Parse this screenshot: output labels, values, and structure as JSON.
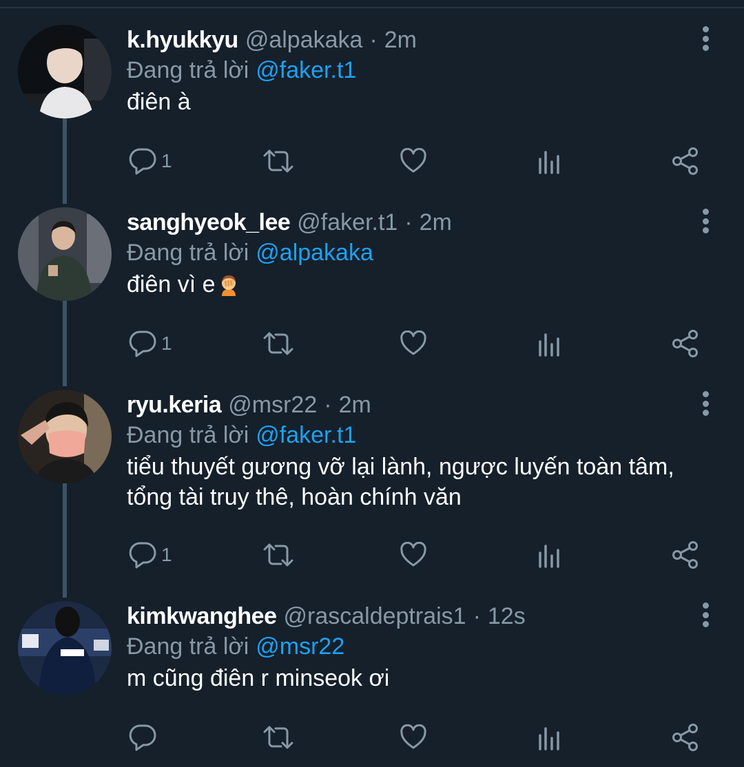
{
  "reply_prefix": "Đang trả lời",
  "colors": {
    "background": "#15202b",
    "text_primary": "#ffffff",
    "text_secondary": "#8899a6",
    "accent": "#1da1f2",
    "thread_line": "#3d5466"
  },
  "icons": {
    "reply": "reply-icon",
    "retweet": "retweet-icon",
    "like": "heart-icon",
    "analytics": "analytics-icon",
    "share": "share-icon",
    "more": "more-vertical-icon"
  },
  "tweets": [
    {
      "name": "k.hyukkyu",
      "handle": "@alpakaka",
      "time": "2m",
      "reply_to": "@faker.t1",
      "text": "điên à",
      "reply_count": "1"
    },
    {
      "name": "sanghyeok_lee",
      "handle": "@faker.t1",
      "time": "2m",
      "reply_to": "@alpakaka",
      "text": "điên vì e",
      "emoji": "person-facepalming-emoji",
      "reply_count": "1"
    },
    {
      "name": "ryu.keria",
      "handle": "@msr22",
      "time": "2m",
      "reply_to": "@faker.t1",
      "text": "tiểu thuyết gương vỡ lại lành, ngược luyến toàn tâm, tổng tài truy thê, hoàn chính văn",
      "reply_count": "1"
    },
    {
      "name": "kimkwanghee",
      "handle": "@rascaldeptrais1",
      "time": "12s",
      "reply_to": "@msr22",
      "text": "m cũng điên r minseok ơi",
      "reply_count": ""
    }
  ]
}
